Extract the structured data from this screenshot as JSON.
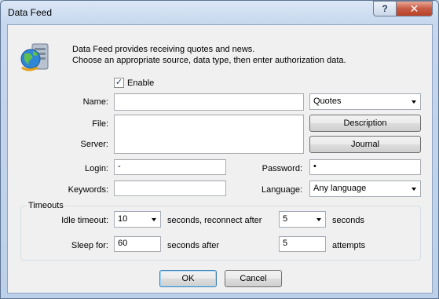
{
  "window": {
    "title": "Data Feed",
    "help_label": "?",
    "close_label": "✕"
  },
  "intro": {
    "line1": "Data Feed provides receiving quotes and news.",
    "line2": "Choose an appropriate source, data type, then enter authorization data.",
    "icon": "data-feed-server-globe-icon"
  },
  "enable": {
    "label": "Enable",
    "checked": true
  },
  "fields": {
    "name_label": "Name:",
    "name_value": "",
    "file_label": "File:",
    "file_value": "",
    "server_label": "Server:",
    "server_value": "",
    "login_label": "Login:",
    "login_value": "-",
    "password_label": "Password:",
    "password_value": "•",
    "keywords_label": "Keywords:",
    "keywords_value": "",
    "language_label": "Language:",
    "language_value": "Any language"
  },
  "type_select": {
    "value": "Quotes"
  },
  "buttons": {
    "description": "Description",
    "journal": "Journal",
    "ok": "OK",
    "cancel": "Cancel"
  },
  "timeouts": {
    "title": "Timeouts",
    "idle_label": "Idle timeout:",
    "idle_value": "10",
    "reconnect_label": "seconds, reconnect after",
    "reconnect_value": "5",
    "reconnect_unit": "seconds",
    "sleep_label": "Sleep for:",
    "sleep_value": "60",
    "after_label": "seconds after",
    "attempts_value": "5",
    "attempts_label": "attempts"
  }
}
